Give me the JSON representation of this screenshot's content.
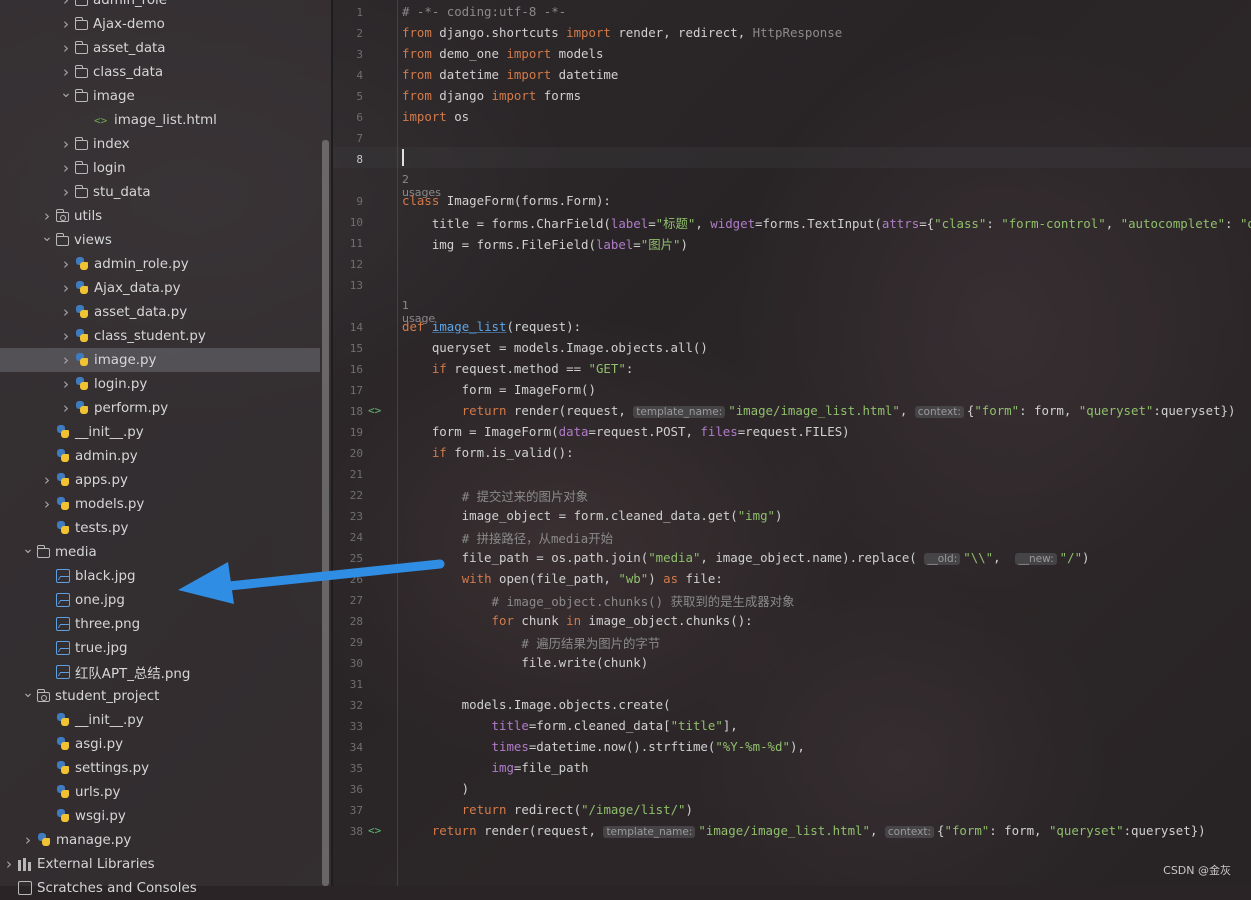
{
  "tree": {
    "rows": [
      {
        "label": "admin_role",
        "indent": 3,
        "type": "folder",
        "chev": "closed"
      },
      {
        "label": "Ajax-demo",
        "indent": 3,
        "type": "folder",
        "chev": "closed"
      },
      {
        "label": "asset_data",
        "indent": 3,
        "type": "folder",
        "chev": "closed"
      },
      {
        "label": "class_data",
        "indent": 3,
        "type": "folder",
        "chev": "closed"
      },
      {
        "label": "image",
        "indent": 3,
        "type": "folder",
        "chev": "open"
      },
      {
        "label": "image_list.html",
        "indent": 4,
        "type": "html",
        "chev": "none"
      },
      {
        "label": "index",
        "indent": 3,
        "type": "folder",
        "chev": "closed"
      },
      {
        "label": "login",
        "indent": 3,
        "type": "folder",
        "chev": "closed"
      },
      {
        "label": "stu_data",
        "indent": 3,
        "type": "folder",
        "chev": "closed"
      },
      {
        "label": "utils",
        "indent": 2,
        "type": "pkg",
        "chev": "closed"
      },
      {
        "label": "views",
        "indent": 2,
        "type": "folder",
        "chev": "open"
      },
      {
        "label": "admin_role.py",
        "indent": 3,
        "type": "py",
        "chev": "closed"
      },
      {
        "label": "Ajax_data.py",
        "indent": 3,
        "type": "py",
        "chev": "closed"
      },
      {
        "label": "asset_data.py",
        "indent": 3,
        "type": "py",
        "chev": "closed"
      },
      {
        "label": "class_student.py",
        "indent": 3,
        "type": "py",
        "chev": "closed"
      },
      {
        "label": "image.py",
        "indent": 3,
        "type": "py",
        "chev": "closed",
        "selected": true
      },
      {
        "label": "login.py",
        "indent": 3,
        "type": "py",
        "chev": "closed"
      },
      {
        "label": "perform.py",
        "indent": 3,
        "type": "py",
        "chev": "closed"
      },
      {
        "label": "__init__.py",
        "indent": 2,
        "type": "py",
        "chev": "none"
      },
      {
        "label": "admin.py",
        "indent": 2,
        "type": "py",
        "chev": "none"
      },
      {
        "label": "apps.py",
        "indent": 2,
        "type": "py",
        "chev": "closed"
      },
      {
        "label": "models.py",
        "indent": 2,
        "type": "py",
        "chev": "closed"
      },
      {
        "label": "tests.py",
        "indent": 2,
        "type": "py",
        "chev": "none"
      },
      {
        "label": "media",
        "indent": 1,
        "type": "folder",
        "chev": "open"
      },
      {
        "label": "black.jpg",
        "indent": 2,
        "type": "img",
        "chev": "none"
      },
      {
        "label": "one.jpg",
        "indent": 2,
        "type": "img",
        "chev": "none"
      },
      {
        "label": "three.png",
        "indent": 2,
        "type": "img",
        "chev": "none"
      },
      {
        "label": "true.jpg",
        "indent": 2,
        "type": "img",
        "chev": "none"
      },
      {
        "label": "红队APT_总结.png",
        "indent": 2,
        "type": "img",
        "chev": "none"
      },
      {
        "label": "student_project",
        "indent": 1,
        "type": "pkg",
        "chev": "open"
      },
      {
        "label": "__init__.py",
        "indent": 2,
        "type": "py",
        "chev": "none"
      },
      {
        "label": "asgi.py",
        "indent": 2,
        "type": "py",
        "chev": "none"
      },
      {
        "label": "settings.py",
        "indent": 2,
        "type": "py",
        "chev": "none"
      },
      {
        "label": "urls.py",
        "indent": 2,
        "type": "py",
        "chev": "none"
      },
      {
        "label": "wsgi.py",
        "indent": 2,
        "type": "py",
        "chev": "none"
      },
      {
        "label": "manage.py",
        "indent": 1,
        "type": "py",
        "chev": "closed"
      },
      {
        "label": "External Libraries",
        "indent": 0,
        "type": "lib",
        "chev": "closed"
      },
      {
        "label": "Scratches and Consoles",
        "indent": 0,
        "type": "scratch",
        "chev": "none"
      }
    ]
  },
  "editor": {
    "current_line": 8,
    "lines": [
      {
        "n": 1,
        "html": "<span class=\"cm\"># -*- coding:utf-8 -*-</span>"
      },
      {
        "n": 2,
        "html": "<span class=\"kw\">from</span> django.shortcuts <span class=\"kw\">import</span> render, redirect, <span class=\"cm\">HttpResponse</span>"
      },
      {
        "n": 3,
        "html": "<span class=\"kw\">from</span> demo_one <span class=\"kw\">import</span> models"
      },
      {
        "n": 4,
        "html": "<span class=\"kw\">from</span> datetime <span class=\"kw\">import</span> datetime"
      },
      {
        "n": 5,
        "html": "<span class=\"kw\">from</span> django <span class=\"kw\">import</span> forms"
      },
      {
        "n": 6,
        "html": "<span class=\"kw\">import</span> os"
      },
      {
        "n": 7,
        "html": ""
      },
      {
        "n": 8,
        "html": ""
      },
      {
        "n": 9,
        "html": "<span class=\"kw\">class</span> ImageForm(forms.Form):",
        "hint": "2 usages"
      },
      {
        "n": 10,
        "html": "    title = forms.CharField(<span class=\"par\">label</span>=<span class=\"str\">\"标题\"</span>, <span class=\"par\">widget</span>=forms.TextInput(<span class=\"par\">attrs</span>={<span class=\"str\">\"class\"</span>: <span class=\"str\">\"form-control\"</span>, <span class=\"str\">\"autocomplete\"</span>: <span class=\"str\">\"off\"</span>}))"
      },
      {
        "n": 11,
        "html": "    img = forms.FileField(<span class=\"par\">label</span>=<span class=\"str\">\"图片\"</span>)"
      },
      {
        "n": 12,
        "html": ""
      },
      {
        "n": 13,
        "html": ""
      },
      {
        "n": 14,
        "html": "<span class=\"kw\">def</span> <span class=\"fn\">image_list</span>(request):",
        "hint": "1 usage"
      },
      {
        "n": 15,
        "html": "    queryset = models.Image.objects.all()"
      },
      {
        "n": 16,
        "html": "    <span class=\"kw\">if</span> request.method == <span class=\"str\">\"GET\"</span>:"
      },
      {
        "n": 17,
        "html": "        form = ImageForm()"
      },
      {
        "n": 18,
        "html": "        <span class=\"kw\">return</span> render(request, <span class=\"inl\">template_name:</span><span class=\"str\">\"image/image_list.html\"</span>, <span class=\"inl\">context:</span>{<span class=\"str\">\"form\"</span>: form, <span class=\"str\">\"queryset\"</span>:queryset})",
        "gicon": "<>"
      },
      {
        "n": 19,
        "html": "    form = ImageForm(<span class=\"par\">data</span>=request.POST, <span class=\"par\">files</span>=request.FILES)"
      },
      {
        "n": 20,
        "html": "    <span class=\"kw\">if</span> form.is_valid():"
      },
      {
        "n": 21,
        "html": ""
      },
      {
        "n": 22,
        "html": "        <span class=\"cm\"># 提交过来的图片对象</span>"
      },
      {
        "n": 23,
        "html": "        image_object = form.cleaned_data.get(<span class=\"str\">\"img\"</span>)"
      },
      {
        "n": 24,
        "html": "        <span class=\"cm\"># 拼接路径，从media开始</span>"
      },
      {
        "n": 25,
        "html": "        file_path = os.path.join(<span class=\"str\">\"media\"</span>, image_object.name).replace( <span class=\"inl\">__old:</span><span class=\"str\">\"\\\\\"</span>,  <span class=\"inl\">__new:</span><span class=\"str\">\"/\"</span>)"
      },
      {
        "n": 26,
        "html": "        <span class=\"kw\">with</span> open(file_path, <span class=\"str\">\"wb\"</span>) <span class=\"kw\">as</span> file:"
      },
      {
        "n": 27,
        "html": "            <span class=\"cm\"># image_object.chunks() 获取到的是生成器对象</span>"
      },
      {
        "n": 28,
        "html": "            <span class=\"kw\">for</span> chunk <span class=\"kw\">in</span> image_object.chunks():"
      },
      {
        "n": 29,
        "html": "                <span class=\"cm\"># 遍历结果为图片的字节</span>"
      },
      {
        "n": 30,
        "html": "                file.write(chunk)"
      },
      {
        "n": 31,
        "html": ""
      },
      {
        "n": 32,
        "html": "        models.Image.objects.create("
      },
      {
        "n": 33,
        "html": "            <span class=\"par\">title</span>=form.cleaned_data[<span class=\"str\">\"title\"</span>],"
      },
      {
        "n": 34,
        "html": "            <span class=\"par\">times</span>=datetime.now().strftime(<span class=\"str\">\"%Y-%m-%d\"</span>),"
      },
      {
        "n": 35,
        "html": "            <span class=\"par\">img</span>=file_path"
      },
      {
        "n": 36,
        "html": "        )"
      },
      {
        "n": 37,
        "html": "        <span class=\"kw\">return</span> redirect(<span class=\"str\">\"/image/list/\"</span>)"
      },
      {
        "n": 38,
        "html": "    <span class=\"kw\">return</span> render(request, <span class=\"inl\">template_name:</span><span class=\"str\">\"image/image_list.html\"</span>, <span class=\"inl\">context:</span>{<span class=\"str\">\"form\"</span>: form, <span class=\"str\">\"queryset\"</span>:queryset})",
        "gicon": "<>"
      }
    ]
  },
  "watermark": "CSDN @金灰",
  "colors": {
    "keyword": "#d27a4a",
    "string": "#8fbf6c",
    "comment": "#8a8a8a",
    "param": "#b07cc8",
    "arrow": "#2f8de4"
  }
}
